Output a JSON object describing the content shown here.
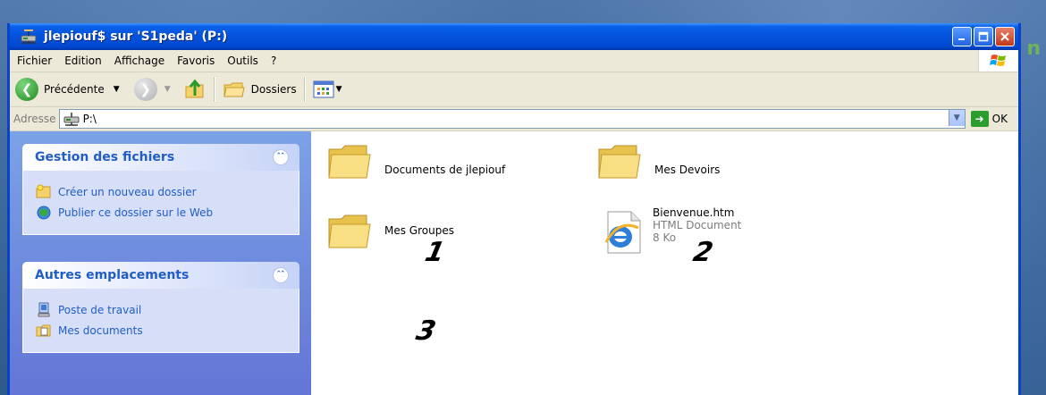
{
  "window": {
    "title": "jlepiouf$ sur 'S1peda' (P:)",
    "buttons": [
      "minimize",
      "maximize",
      "close"
    ]
  },
  "menubar": {
    "items": [
      "Fichier",
      "Edition",
      "Affichage",
      "Favoris",
      "Outils",
      "?"
    ]
  },
  "toolbar": {
    "back_label": "Précédente",
    "folders_label": "Dossiers"
  },
  "address": {
    "label": "Adresse",
    "value": "P:\\",
    "go_label": "OK"
  },
  "tasks_panel": {
    "title": "Gestion des fichiers",
    "items": [
      {
        "label": "Créer un nouveau dossier",
        "icon": "new-folder-icon"
      },
      {
        "label": "Publier ce dossier sur le Web",
        "icon": "publish-web-icon"
      }
    ]
  },
  "places_panel": {
    "title": "Autres emplacements",
    "items": [
      {
        "label": "Poste de travail",
        "icon": "my-computer-icon"
      },
      {
        "label": "Mes documents",
        "icon": "my-documents-icon"
      }
    ]
  },
  "files": [
    {
      "name": "Documents de jlepiouf",
      "type": "folder",
      "annotation": "1"
    },
    {
      "name": "Mes Devoirs",
      "type": "folder",
      "annotation": "2"
    },
    {
      "name": "Mes Groupes",
      "type": "folder",
      "annotation": "3"
    },
    {
      "name": "Bienvenue.htm",
      "type": "HTML Document",
      "size": "8 Ko",
      "icon": "ie-icon"
    }
  ],
  "background": {
    "letter": "n"
  },
  "colors": {
    "titlebar": "#0553dd",
    "task_link": "#215dc6",
    "pane": "#7ba2e7"
  }
}
